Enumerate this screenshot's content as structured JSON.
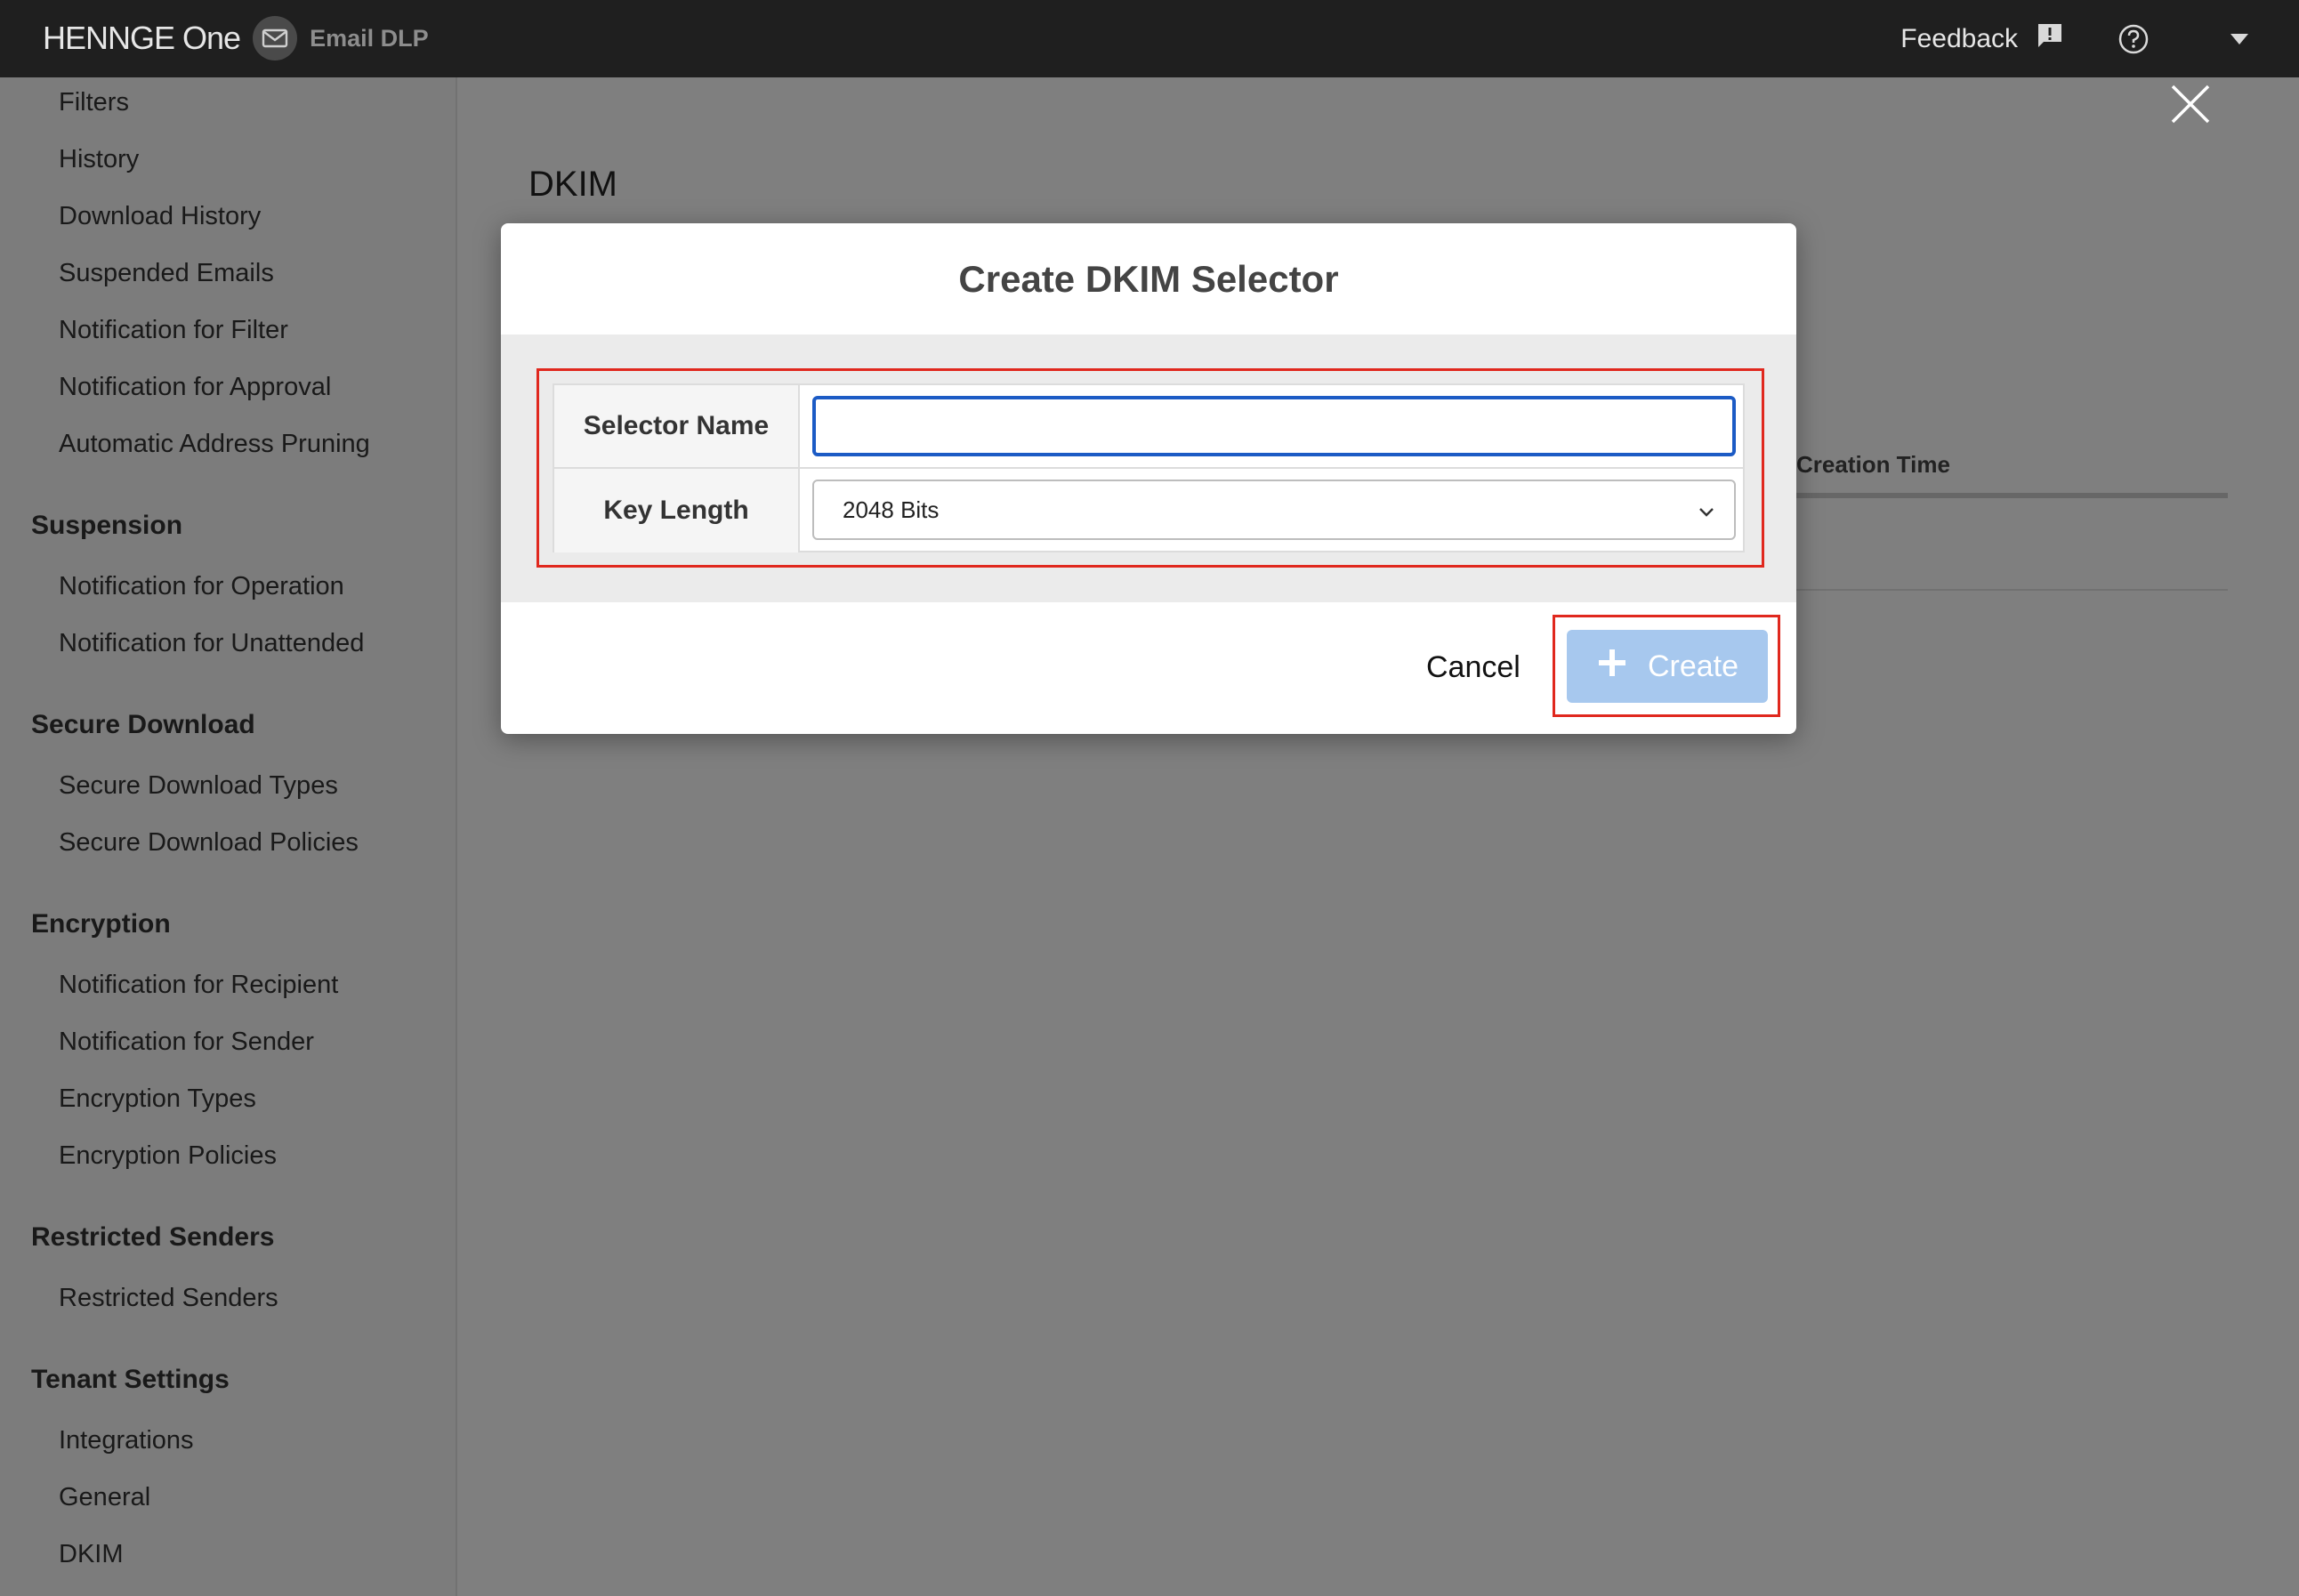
{
  "header": {
    "brand": "HENNGE One",
    "product": "Email DLP",
    "feedback_label": "Feedback",
    "icons": [
      "mail-icon",
      "feedback-icon",
      "help-icon",
      "dropdown-icon"
    ]
  },
  "sidebar": {
    "items_top": [
      "Filters",
      "History",
      "Download History",
      "Suspended Emails",
      "Notification for Filter",
      "Notification for Approval",
      "Automatic Address Pruning"
    ],
    "sections": [
      {
        "title": "Suspension",
        "items": [
          "Notification for Operation",
          "Notification for Unattended"
        ]
      },
      {
        "title": "Secure Download",
        "items": [
          "Secure Download Types",
          "Secure Download Policies"
        ]
      },
      {
        "title": "Encryption",
        "items": [
          "Notification for Recipient",
          "Notification for Sender",
          "Encryption Types",
          "Encryption Policies"
        ]
      },
      {
        "title": "Restricted Senders",
        "items": [
          "Restricted Senders"
        ]
      },
      {
        "title": "Tenant Settings",
        "items": [
          "Integrations",
          "General",
          "DKIM"
        ]
      }
    ]
  },
  "main": {
    "title": "DKIM",
    "column_header": "Creation Time"
  },
  "modal": {
    "title": "Create DKIM Selector",
    "selector_name_label": "Selector Name",
    "selector_name_value": "",
    "key_length_label": "Key Length",
    "key_length_value": "2048 Bits",
    "cancel_label": "Cancel",
    "create_label": "Create",
    "highlight_color": "#e0281e",
    "focus_color": "#1c5bc5",
    "create_button_color": "#a7c8ee"
  }
}
